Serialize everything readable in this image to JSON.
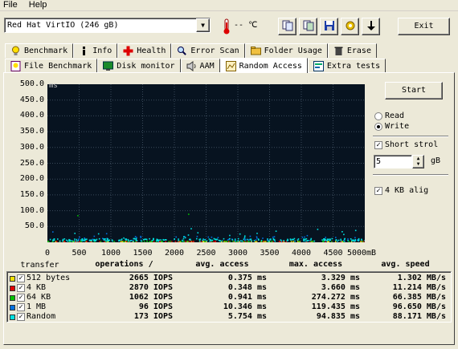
{
  "menu": {
    "file": "File",
    "help": "Help"
  },
  "drive": {
    "selected": "Red Hat VirtIO (246 gB)"
  },
  "temp_text": "-- ",
  "exit_label": "Exit",
  "tabs_row1": [
    {
      "label": "Benchmark",
      "icon": "bulb-icon"
    },
    {
      "label": "Info",
      "icon": "info-icon"
    },
    {
      "label": "Health",
      "icon": "health-cross-icon"
    },
    {
      "label": "Error Scan",
      "icon": "magnifier-icon"
    },
    {
      "label": "Folder Usage",
      "icon": "folder-icon"
    },
    {
      "label": "Erase",
      "icon": "trash-icon"
    }
  ],
  "tabs_row2": [
    {
      "label": "File Benchmark",
      "icon": "file-bulb-icon"
    },
    {
      "label": "Disk monitor",
      "icon": "monitor-icon"
    },
    {
      "label": "AAM",
      "icon": "speaker-icon"
    },
    {
      "label": "Random Access",
      "icon": "random-access-icon",
      "active": true
    },
    {
      "label": "Extra tests",
      "icon": "extra-tests-icon"
    }
  ],
  "controls": {
    "start_label": "Start",
    "read_label": "Read",
    "write_label": "Write",
    "selected_mode": "Write",
    "short_stroke_label": "Short strol",
    "short_stroke_checked": true,
    "short_stroke_value": "5",
    "short_stroke_unit": "gB",
    "align_label": "4 KB alig",
    "align_checked": true
  },
  "chart_data": {
    "type": "scatter",
    "ylabel": "ms",
    "xlabel": "mB",
    "ylim": [
      0,
      500
    ],
    "xlim": [
      0,
      5000
    ],
    "y_ticks": [
      "500.0",
      "450.0",
      "400.0",
      "350.0",
      "300.0",
      "250.0",
      "200.0",
      "150.0",
      "100.0",
      "50.0"
    ],
    "x_ticks": [
      "0",
      "500",
      "1000",
      "1500",
      "2000",
      "2500",
      "3000",
      "3500",
      "4000",
      "4500",
      "5000mB"
    ],
    "grid": true,
    "background": "#071320",
    "series": [
      {
        "name": "512 bytes",
        "color": "#f0e000",
        "avg_ms": 0.375,
        "max_ms": 3.329
      },
      {
        "name": "4 KB",
        "color": "#e00000",
        "avg_ms": 0.348,
        "max_ms": 3.66
      },
      {
        "name": "64 KB",
        "color": "#00c000",
        "avg_ms": 0.941,
        "max_ms": 274.272
      },
      {
        "name": "1 MB",
        "color": "#0070e0",
        "avg_ms": 10.346,
        "max_ms": 119.435
      },
      {
        "name": "Random",
        "color": "#00e0e0",
        "avg_ms": 5.754,
        "max_ms": 94.835
      }
    ]
  },
  "table": {
    "headers": [
      "transfer",
      "operations /",
      "avg. access",
      "max. access",
      "avg. speed"
    ],
    "rows": [
      {
        "transfer": "512 bytes",
        "color": "#f0e000",
        "ops": "2665 IOPS",
        "avg": "0.375 ms",
        "max": "3.329 ms",
        "speed": "1.302 MB/s"
      },
      {
        "transfer": "4 KB",
        "color": "#e00000",
        "ops": "2870 IOPS",
        "avg": "0.348 ms",
        "max": "3.660 ms",
        "speed": "11.214 MB/s"
      },
      {
        "transfer": "64 KB",
        "color": "#00c000",
        "ops": "1062 IOPS",
        "avg": "0.941 ms",
        "max": "274.272 ms",
        "speed": "66.385 MB/s"
      },
      {
        "transfer": "1 MB",
        "color": "#0070e0",
        "ops": "96 IOPS",
        "avg": "10.346 ms",
        "max": "119.435 ms",
        "speed": "96.650 MB/s"
      },
      {
        "transfer": "Random",
        "color": "#00e0e0",
        "ops": "173 IOPS",
        "avg": "5.754 ms",
        "max": "94.835 ms",
        "speed": "88.171 MB/s"
      }
    ]
  }
}
